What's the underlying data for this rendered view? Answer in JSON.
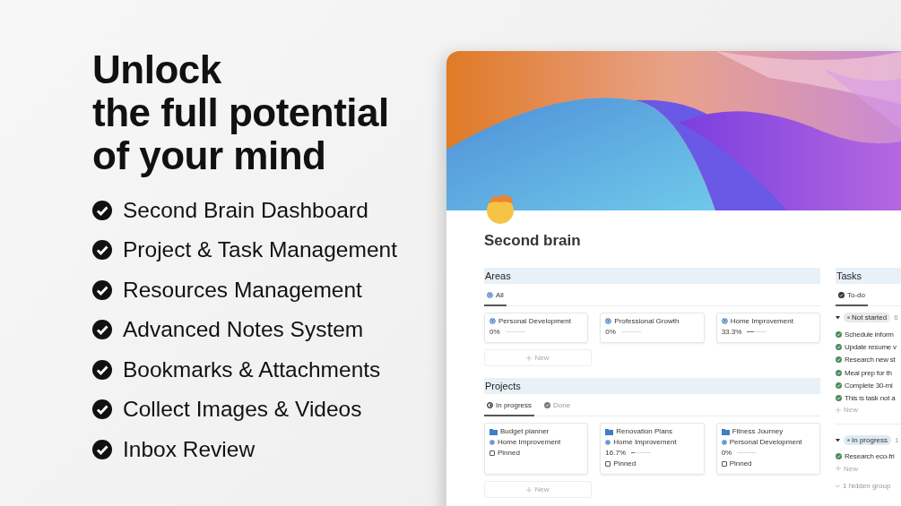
{
  "hero": {
    "headline": [
      "Unlock",
      "the full potential",
      "of your mind"
    ],
    "features": [
      "Second Brain Dashboard",
      "Project & Task Management",
      "Resources Management",
      "Advanced Notes System",
      "Bookmarks & Attachments",
      "Collect Images & Videos",
      "Inbox Review"
    ]
  },
  "page": {
    "title": "Second brain",
    "areas": {
      "title": "Areas",
      "tabs": [
        {
          "label": "All",
          "selected": true
        }
      ],
      "cards": [
        {
          "name": "Personal Development",
          "progress": "0%",
          "level": 0
        },
        {
          "name": "Professional Growth",
          "progress": "0%",
          "level": 0
        },
        {
          "name": "Home Improvement",
          "progress": "33.3%",
          "level": 0.333
        }
      ],
      "new_button": "New"
    },
    "projects": {
      "title": "Projects",
      "tabs": [
        {
          "label": "In progress",
          "selected": true
        },
        {
          "label": "Done",
          "selected": false
        }
      ],
      "cards": [
        {
          "name": "Budget planner",
          "area": "Home Improvement",
          "pinned_label": "Pinned",
          "pinned": false
        },
        {
          "name": "Renovation Plans",
          "area": "Home Improvement",
          "progress": "16.7%",
          "level": 0.167,
          "pinned_label": "Pinned",
          "pinned": false
        },
        {
          "name": "Fitness Journey",
          "area": "Personal Development",
          "progress": "0%",
          "level": 0,
          "pinned_label": "Pinned",
          "pinned": false
        }
      ],
      "new_button": "New"
    },
    "tasks": {
      "title": "Tasks",
      "tabs": [
        {
          "label": "To-do",
          "selected": true
        }
      ],
      "groups": [
        {
          "status": "Not started",
          "color": "#91918e",
          "count": "6",
          "expanded": true,
          "items": [
            "Schedule inform",
            "Update resume v",
            "Research new st",
            "Meal prep for th",
            "Complete 30-mi",
            "This is task not a"
          ],
          "new_label": "New"
        },
        {
          "status": "In progress",
          "color": "#5b97bd",
          "count": "1",
          "expanded": true,
          "items": [
            "Research eco-fri"
          ],
          "new_label": "New"
        }
      ],
      "hidden_groups": "1 hidden group"
    }
  }
}
